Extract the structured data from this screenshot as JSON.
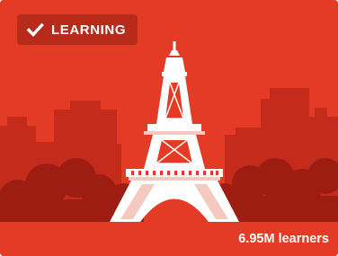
{
  "card": {
    "status_label": "LEARNING",
    "status_icon": "check-icon",
    "illustration": "eiffel-tower-icon",
    "learners_text": "6.95M learners"
  },
  "colors": {
    "card_background": "#e33b25",
    "skyline": "#c42b1b",
    "bushes": "#9e1d12",
    "tower": "#ffffff",
    "tower_shade": "#f4c9c0"
  }
}
